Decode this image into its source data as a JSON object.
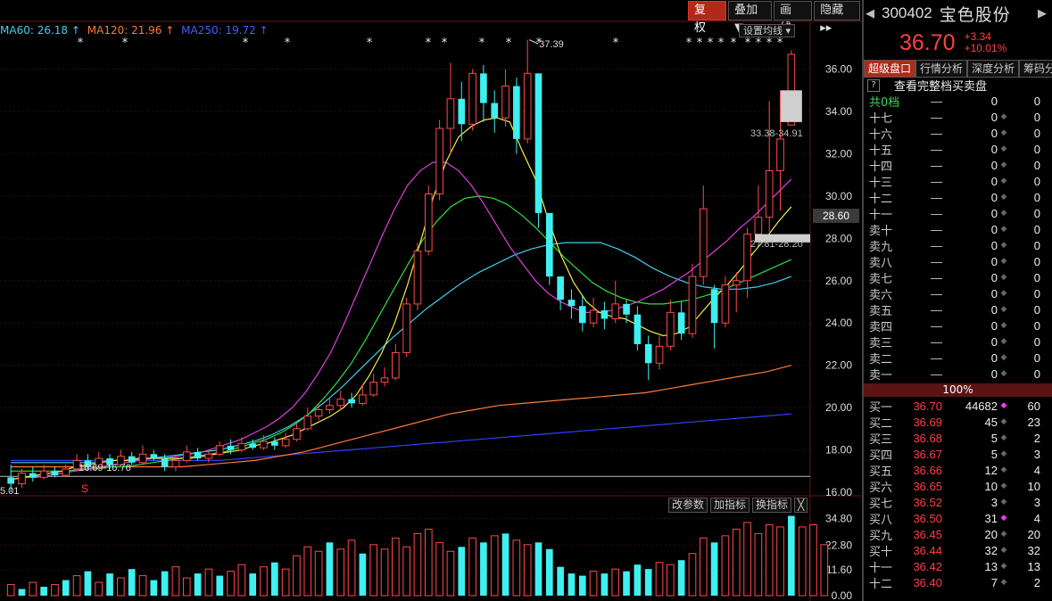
{
  "stock": {
    "code": "300402",
    "name": "宝色股份",
    "price": "36.70",
    "change": "+3.34",
    "change_pct": "+10.01%"
  },
  "toolbar": [
    {
      "label": "复 权",
      "active": true
    },
    {
      "label": "叠加▼",
      "active": false
    },
    {
      "label": "画 线",
      "active": false
    },
    {
      "label": "隐藏▸▸",
      "active": false
    }
  ],
  "ma_legend": {
    "ma60": {
      "text": "MA60: 26.18 ↑",
      "color": "#3fd0f0"
    },
    "ma120": {
      "text": "MA120: 21.96 ↑",
      "color": "#ff7a3a"
    },
    "ma250": {
      "text": "MA250: 19.72 ↑",
      "color": "#4060ff"
    }
  },
  "set_ma_label": "设置均线",
  "current_price_flag": "28.60",
  "annotations": {
    "high": "37.39",
    "low_range": "16.69-16.76",
    "range_a": "33.38-34.91",
    "range_b": "27.81-28.20",
    "low_left": "5.01",
    "s_marker": "S"
  },
  "volume_buttons": [
    "改参数",
    "加指标",
    "换指标",
    "╳"
  ],
  "tabs": [
    {
      "label": "超级盘口",
      "active": true
    },
    {
      "label": "行情分析",
      "active": false
    },
    {
      "label": "深度分析",
      "active": false
    },
    {
      "label": "筹码分",
      "active": false
    }
  ],
  "view_full": "查看完整档买卖盘",
  "gong_row": {
    "label": "共0档",
    "price": "—",
    "vol": "0",
    "cnt": "0"
  },
  "sell_rows": [
    {
      "label": "十七",
      "price": "—",
      "vol": "0",
      "cnt": "0"
    },
    {
      "label": "十六",
      "price": "—",
      "vol": "0",
      "cnt": "0"
    },
    {
      "label": "十五",
      "price": "—",
      "vol": "0",
      "cnt": "0"
    },
    {
      "label": "十四",
      "price": "—",
      "vol": "0",
      "cnt": "0"
    },
    {
      "label": "十三",
      "price": "—",
      "vol": "0",
      "cnt": "0"
    },
    {
      "label": "十二",
      "price": "—",
      "vol": "0",
      "cnt": "0"
    },
    {
      "label": "十一",
      "price": "—",
      "vol": "0",
      "cnt": "0"
    },
    {
      "label": "卖十",
      "price": "—",
      "vol": "0",
      "cnt": "0"
    },
    {
      "label": "卖九",
      "price": "—",
      "vol": "0",
      "cnt": "0"
    },
    {
      "label": "卖八",
      "price": "—",
      "vol": "0",
      "cnt": "0"
    },
    {
      "label": "卖七",
      "price": "—",
      "vol": "0",
      "cnt": "0"
    },
    {
      "label": "卖六",
      "price": "—",
      "vol": "0",
      "cnt": "0"
    },
    {
      "label": "卖五",
      "price": "—",
      "vol": "0",
      "cnt": "0"
    },
    {
      "label": "卖四",
      "price": "—",
      "vol": "0",
      "cnt": "0"
    },
    {
      "label": "卖三",
      "price": "—",
      "vol": "0",
      "cnt": "0"
    },
    {
      "label": "卖二",
      "price": "—",
      "vol": "0",
      "cnt": "0"
    },
    {
      "label": "卖一",
      "price": "—",
      "vol": "0",
      "cnt": "0"
    }
  ],
  "pct_bar": "100%",
  "buy_rows": [
    {
      "label": "买一",
      "price": "36.70",
      "vol": "44682",
      "cnt": "60",
      "dot": true
    },
    {
      "label": "买二",
      "price": "36.69",
      "vol": "45",
      "cnt": "23",
      "dot": false
    },
    {
      "label": "买三",
      "price": "36.68",
      "vol": "5",
      "cnt": "2",
      "dot": false
    },
    {
      "label": "买四",
      "price": "36.67",
      "vol": "5",
      "cnt": "3",
      "dot": false
    },
    {
      "label": "买五",
      "price": "36.66",
      "vol": "12",
      "cnt": "4",
      "dot": false
    },
    {
      "label": "买六",
      "price": "36.65",
      "vol": "10",
      "cnt": "10",
      "dot": false
    },
    {
      "label": "买七",
      "price": "36.52",
      "vol": "3",
      "cnt": "3",
      "dot": false
    },
    {
      "label": "买八",
      "price": "36.50",
      "vol": "31",
      "cnt": "4",
      "dot": true
    },
    {
      "label": "买九",
      "price": "36.45",
      "vol": "20",
      "cnt": "20",
      "dot": false
    },
    {
      "label": "买十",
      "price": "36.44",
      "vol": "32",
      "cnt": "32",
      "dot": false
    },
    {
      "label": "十一",
      "price": "36.42",
      "vol": "13",
      "cnt": "13",
      "dot": false
    },
    {
      "label": "十二",
      "price": "36.40",
      "vol": "7",
      "cnt": "2",
      "dot": false
    }
  ],
  "chart_data": {
    "type": "candlestick",
    "y_ticks": [
      "36.00",
      "34.00",
      "32.00",
      "30.00",
      "28.00",
      "26.00",
      "24.00",
      "22.00",
      "20.00",
      "18.00",
      "16.00"
    ],
    "ylim": [
      16,
      37.5
    ],
    "volume_ticks": [
      "34.80",
      "22.80",
      "11.60",
      "0.00"
    ],
    "volume_ylim": [
      0,
      37
    ],
    "candles": [
      [
        16.7,
        16.4,
        17.3,
        16.0
      ],
      [
        16.4,
        16.9,
        17.1,
        16.2
      ],
      [
        16.9,
        16.7,
        17.2,
        16.5
      ],
      [
        16.7,
        17.0,
        17.3,
        16.6
      ],
      [
        17.0,
        16.8,
        17.2,
        16.7
      ],
      [
        16.8,
        17.1,
        17.3,
        16.7
      ],
      [
        17.1,
        17.5,
        17.8,
        17.0
      ],
      [
        17.5,
        17.2,
        17.8,
        17.0
      ],
      [
        17.2,
        17.6,
        17.9,
        17.1
      ],
      [
        17.6,
        17.3,
        17.8,
        17.1
      ],
      [
        17.3,
        17.7,
        18.0,
        17.2
      ],
      [
        17.7,
        17.4,
        17.9,
        17.3
      ],
      [
        17.4,
        17.8,
        18.2,
        17.3
      ],
      [
        17.8,
        17.6,
        18.0,
        17.5
      ],
      [
        17.6,
        17.2,
        17.8,
        17.0
      ],
      [
        17.2,
        17.5,
        17.7,
        17.0
      ],
      [
        17.5,
        17.9,
        18.2,
        17.4
      ],
      [
        17.9,
        17.6,
        18.1,
        17.5
      ],
      [
        17.6,
        17.8,
        18.0,
        17.4
      ],
      [
        17.8,
        18.2,
        18.4,
        17.7
      ],
      [
        18.2,
        18.0,
        18.5,
        17.8
      ],
      [
        18.0,
        18.3,
        18.6,
        17.9
      ],
      [
        18.3,
        18.1,
        18.5,
        18.0
      ],
      [
        18.1,
        18.4,
        18.7,
        18.0
      ],
      [
        18.4,
        18.2,
        18.6,
        18.0
      ],
      [
        18.2,
        18.5,
        18.8,
        18.1
      ],
      [
        18.5,
        19.0,
        19.3,
        18.4
      ],
      [
        19.0,
        19.6,
        20.0,
        18.9
      ],
      [
        19.6,
        19.9,
        20.2,
        19.4
      ],
      [
        19.9,
        20.1,
        20.5,
        19.7
      ],
      [
        20.1,
        20.4,
        20.8,
        19.9
      ],
      [
        20.4,
        20.2,
        20.7,
        20.0
      ],
      [
        20.2,
        20.6,
        21.1,
        20.1
      ],
      [
        20.6,
        21.2,
        21.6,
        20.5
      ],
      [
        21.2,
        21.4,
        21.9,
        21.0
      ],
      [
        21.4,
        22.6,
        23.0,
        21.3
      ],
      [
        22.6,
        24.9,
        25.2,
        22.4
      ],
      [
        24.9,
        27.4,
        27.8,
        24.6
      ],
      [
        27.4,
        30.1,
        30.5,
        27.2
      ],
      [
        30.1,
        33.2,
        33.6,
        29.8
      ],
      [
        33.2,
        34.6,
        36.3,
        32.0
      ],
      [
        34.6,
        33.4,
        35.4,
        32.6
      ],
      [
        33.4,
        35.8,
        36.0,
        33.1
      ],
      [
        35.8,
        34.4,
        36.2,
        33.5
      ],
      [
        34.4,
        33.7,
        35.0,
        33.0
      ],
      [
        33.7,
        35.2,
        36.0,
        33.3
      ],
      [
        35.2,
        32.7,
        35.6,
        32.0
      ],
      [
        32.7,
        35.8,
        37.39,
        32.5
      ],
      [
        35.8,
        29.2,
        30.5,
        28.5
      ],
      [
        29.2,
        26.2,
        27.4,
        25.8
      ],
      [
        26.2,
        25.1,
        25.9,
        24.6
      ],
      [
        25.1,
        24.8,
        25.6,
        24.2
      ],
      [
        24.8,
        24.0,
        25.3,
        23.6
      ],
      [
        24.0,
        24.6,
        25.2,
        23.8
      ],
      [
        24.6,
        24.2,
        25.0,
        23.7
      ],
      [
        24.2,
        24.9,
        26.0,
        24.0
      ],
      [
        24.9,
        24.4,
        25.1,
        24.0
      ],
      [
        24.4,
        23.0,
        24.8,
        22.7
      ],
      [
        23.0,
        22.1,
        23.4,
        21.3
      ],
      [
        22.1,
        22.9,
        23.4,
        21.8
      ],
      [
        22.9,
        24.5,
        25.1,
        22.7
      ],
      [
        24.5,
        23.5,
        25.0,
        23.2
      ],
      [
        23.5,
        26.2,
        26.8,
        23.3
      ],
      [
        26.2,
        29.4,
        30.5,
        25.8
      ],
      [
        25.6,
        24.0,
        25.8,
        22.8
      ],
      [
        24.0,
        25.8,
        26.2,
        23.8
      ],
      [
        25.8,
        26.0,
        26.4,
        24.5
      ],
      [
        26.0,
        28.2,
        28.5,
        25.2
      ],
      [
        28.2,
        29.0,
        30.5,
        28.0
      ],
      [
        29.0,
        31.2,
        34.5,
        28.3
      ],
      [
        31.2,
        32.7,
        35.0,
        29.3
      ],
      [
        33.36,
        36.7,
        36.9,
        33.36
      ]
    ],
    "volumes": [
      [
        5,
        1
      ],
      [
        3,
        0
      ],
      [
        6,
        1
      ],
      [
        4,
        0
      ],
      [
        5,
        1
      ],
      [
        7,
        0
      ],
      [
        9,
        1
      ],
      [
        11,
        0
      ],
      [
        6,
        1
      ],
      [
        10,
        0
      ],
      [
        8,
        1
      ],
      [
        12,
        0
      ],
      [
        9,
        1
      ],
      [
        7,
        0
      ],
      [
        11,
        0
      ],
      [
        13,
        1
      ],
      [
        8,
        1
      ],
      [
        10,
        0
      ],
      [
        12,
        1
      ],
      [
        9,
        0
      ],
      [
        11,
        1
      ],
      [
        14,
        1
      ],
      [
        10,
        0
      ],
      [
        13,
        1
      ],
      [
        15,
        0
      ],
      [
        12,
        1
      ],
      [
        18,
        1
      ],
      [
        22,
        1
      ],
      [
        20,
        1
      ],
      [
        24,
        0
      ],
      [
        21,
        1
      ],
      [
        25,
        1
      ],
      [
        19,
        0
      ],
      [
        23,
        1
      ],
      [
        21,
        1
      ],
      [
        26,
        1
      ],
      [
        22,
        1
      ],
      [
        28,
        1
      ],
      [
        30,
        1
      ],
      [
        24,
        1
      ],
      [
        20,
        1
      ],
      [
        22,
        0
      ],
      [
        26,
        1
      ],
      [
        24,
        0
      ],
      [
        27,
        1
      ],
      [
        28,
        0
      ],
      [
        25,
        1
      ],
      [
        23,
        1
      ],
      [
        24,
        0
      ],
      [
        21,
        0
      ],
      [
        13,
        0
      ],
      [
        10,
        0
      ],
      [
        9,
        0
      ],
      [
        11,
        1
      ],
      [
        10,
        0
      ],
      [
        12,
        1
      ],
      [
        11,
        0
      ],
      [
        14,
        0
      ],
      [
        12,
        0
      ],
      [
        15,
        1
      ],
      [
        14,
        1
      ],
      [
        16,
        0
      ],
      [
        19,
        1
      ],
      [
        26,
        1
      ],
      [
        24,
        0
      ],
      [
        27,
        1
      ],
      [
        30,
        1
      ],
      [
        33,
        1
      ],
      [
        28,
        1
      ],
      [
        32,
        1
      ],
      [
        31,
        1
      ],
      [
        36,
        0
      ],
      [
        31,
        1
      ],
      [
        32,
        1
      ],
      [
        23,
        1
      ]
    ],
    "ma5": [
      16.6,
      16.7,
      16.8,
      16.9,
      17.0,
      17.2,
      17.3,
      17.4,
      17.5,
      17.5,
      17.6,
      17.6,
      17.6,
      17.6,
      17.6,
      17.7,
      17.8,
      17.9,
      18.0,
      18.2,
      18.3,
      18.5,
      18.7,
      19.0,
      19.3,
      19.6,
      20.0,
      20.6,
      21.5,
      22.6,
      24.0,
      25.8,
      27.8,
      29.9,
      31.6,
      32.8,
      33.3,
      33.6,
      33.7,
      33.5,
      32.1,
      30.8,
      28.9,
      27.2,
      25.9,
      25.0,
      24.5,
      24.3,
      24.2,
      23.9,
      23.6,
      23.4,
      23.5,
      23.8,
      24.5,
      25.2,
      25.8,
      26.5,
      27.3,
      28.0,
      28.8,
      29.5
    ],
    "ma10": [
      16.6,
      16.7,
      16.7,
      16.8,
      16.9,
      17.0,
      17.1,
      17.2,
      17.3,
      17.4,
      17.5,
      17.6,
      17.6,
      17.7,
      17.8,
      17.9,
      18.1,
      18.3,
      18.5,
      18.8,
      19.1,
      19.5,
      20.0,
      20.7,
      21.6,
      22.6,
      23.9,
      25.3,
      26.7,
      28.1,
      29.4,
      30.5,
      31.2,
      31.6,
      31.6,
      31.2,
      30.5,
      29.6,
      28.6,
      27.6,
      26.8,
      26.0,
      25.4,
      25.0,
      24.7,
      24.5,
      24.5,
      24.6,
      24.8,
      25.0,
      25.3,
      25.6,
      26.0,
      26.4,
      26.9,
      27.4,
      27.9,
      28.5,
      29.0,
      29.6,
      30.2,
      30.8
    ],
    "ma20": [
      17.0,
      17.0,
      17.0,
      17.0,
      17.0,
      17.1,
      17.1,
      17.2,
      17.2,
      17.3,
      17.4,
      17.5,
      17.6,
      17.7,
      17.8,
      17.9,
      18.1,
      18.3,
      18.5,
      18.8,
      19.2,
      19.7,
      20.4,
      21.2,
      22.1,
      23.2,
      24.4,
      25.6,
      26.8,
      27.9,
      28.8,
      29.5,
      29.9,
      30.0,
      29.9,
      29.6,
      29.1,
      28.5,
      27.8,
      27.1,
      26.5,
      25.9,
      25.5,
      25.2,
      25.0,
      24.9,
      24.9,
      25.0,
      25.1,
      25.3,
      25.5,
      25.8,
      26.1,
      26.4,
      26.7,
      27.0
    ],
    "ma60": [
      17.4,
      17.4,
      17.4,
      17.4,
      17.4,
      17.4,
      17.5,
      17.5,
      17.6,
      17.7,
      17.8,
      17.9,
      18.0,
      18.2,
      18.4,
      18.7,
      19.1,
      19.6,
      20.2,
      20.9,
      21.7,
      22.5,
      23.3,
      24.0,
      24.7,
      25.3,
      25.9,
      26.4,
      26.8,
      27.2,
      27.5,
      27.7,
      27.8,
      27.8,
      27.8,
      27.5,
      27.1,
      26.6,
      26.2,
      25.9,
      25.7,
      25.6,
      25.6,
      25.7,
      25.9,
      26.2
    ],
    "ma120": [
      17.2,
      17.2,
      17.2,
      17.2,
      17.2,
      17.2,
      17.2,
      17.2,
      17.3,
      17.4,
      17.5,
      17.7,
      17.9,
      18.2,
      18.5,
      18.8,
      19.1,
      19.4,
      19.7,
      19.9,
      20.1,
      20.2,
      20.3,
      20.4,
      20.5,
      20.6,
      20.7,
      20.9,
      21.1,
      21.3,
      21.5,
      21.7,
      22.0
    ],
    "ma250": [
      17.5,
      17.5,
      17.5,
      17.5,
      17.5,
      17.5,
      17.5,
      17.5,
      17.5,
      17.6,
      17.7,
      17.8,
      17.9,
      18.0,
      18.1,
      18.2,
      18.3,
      18.4,
      18.5,
      18.6,
      18.7,
      18.8,
      18.9,
      19.0,
      19.1,
      19.2,
      19.3,
      19.4,
      19.5,
      19.6,
      19.7
    ],
    "xlabel": "",
    "ylabel": ""
  }
}
